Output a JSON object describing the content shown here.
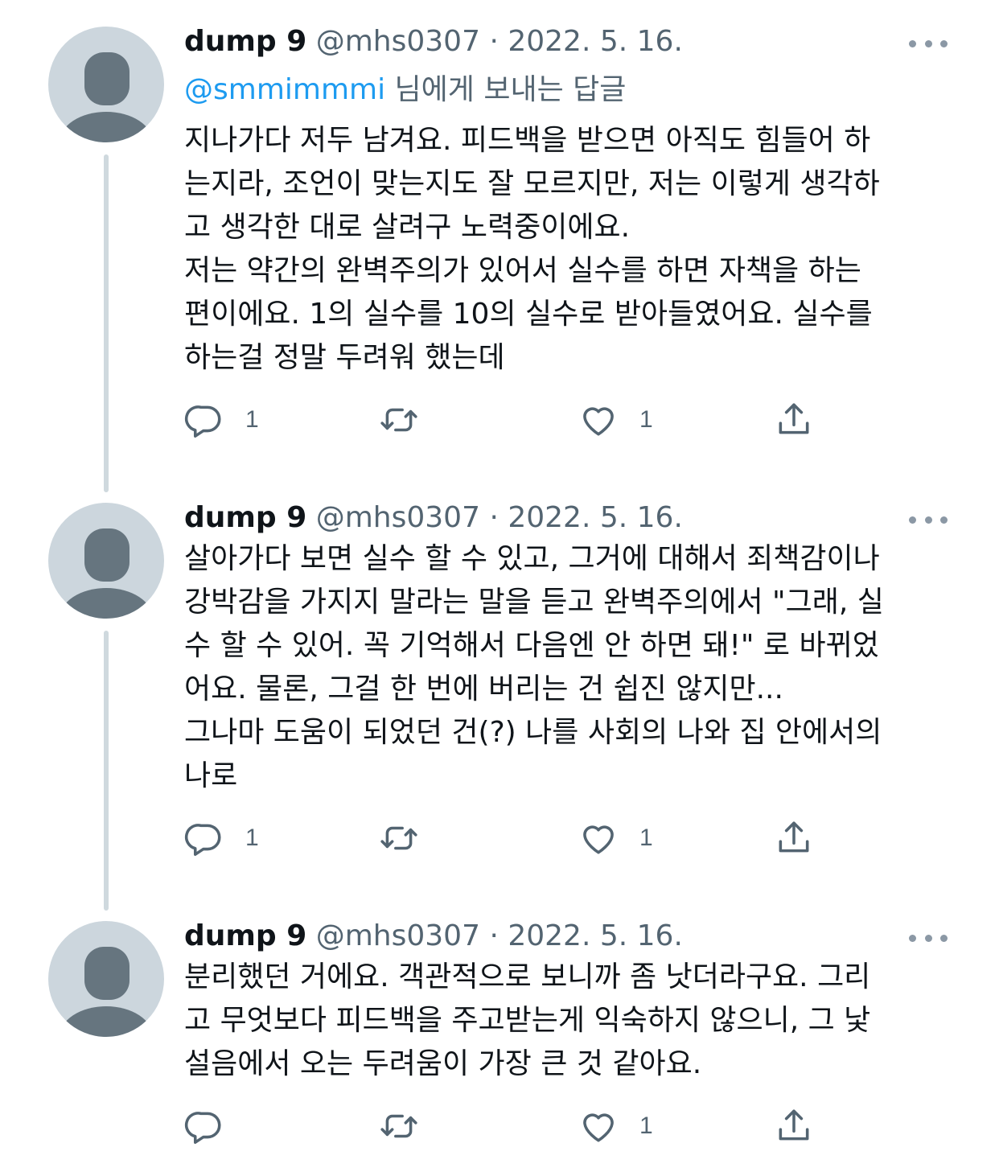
{
  "tweets": [
    {
      "name": "dump 9",
      "handle": "@mhs0307",
      "separator": "·",
      "date": "2022. 5. 16.",
      "replying_to_mention": "@smmimmmi",
      "replying_to_suffix": " 님에게 보내는 답글",
      "lines": [
        "지나가다 저두 남겨요. 피드백을 받으면 아직도 힘들어 하",
        "는지라, 조언이 맞는지도 잘 모르지만, 저는 이렇게 생각하",
        "고 생각한 대로 살려구 노력중이에요.",
        "저는 약간의 완벽주의가 있어서 실수를 하면 자책을 하는",
        "편이에요. 1의 실수를 10의 실수로 받아들였어요. 실수를",
        "하는걸 정말 두려워 했는데"
      ],
      "reply_count": "1",
      "retweet_count": "",
      "like_count": "1"
    },
    {
      "name": "dump 9",
      "handle": "@mhs0307",
      "separator": "·",
      "date": "2022. 5. 16.",
      "lines": [
        "살아가다 보면 실수 할 수 있고, 그거에 대해서 죄책감이나",
        "강박감을 가지지 말라는 말을 듣고 완벽주의에서 \"그래, 실",
        "수 할 수 있어. 꼭 기억해서 다음엔 안 하면 돼!\" 로 바뀌었",
        "어요. 물론, 그걸 한 번에 버리는 건 쉽진 않지만...",
        "그나마 도움이 되었던 건(?) 나를 사회의 나와 집 안에서의",
        "나로"
      ],
      "reply_count": "1",
      "retweet_count": "",
      "like_count": "1"
    },
    {
      "name": "dump 9",
      "handle": "@mhs0307",
      "separator": "·",
      "date": "2022. 5. 16.",
      "lines": [
        "분리했던 거에요. 객관적으로 보니까 좀 낫더라구요. 그리",
        "고 무엇보다 피드백을 주고받는게 익숙하지 않으니, 그 낯",
        "설음에서 오는 두려움이 가장 큰 것 같아요."
      ],
      "reply_count": "",
      "retweet_count": "",
      "like_count": "1"
    }
  ],
  "icons": {
    "reply": "reply-icon",
    "retweet": "retweet-icon",
    "like": "heart-icon",
    "share": "share-icon",
    "more": "more-icon",
    "avatar": "default-avatar-icon"
  },
  "colors": {
    "text": "#0f1419",
    "muted": "#536471",
    "link": "#1d9bf0",
    "avatar_bg": "#ccd6dd",
    "avatar_fg": "#66757f",
    "thread_line": "#cfd9de"
  }
}
